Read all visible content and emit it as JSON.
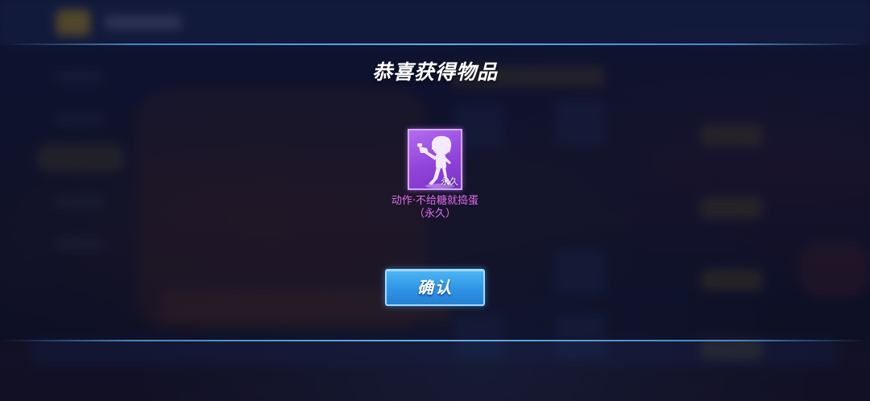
{
  "popup": {
    "title": "恭喜获得物品",
    "item": {
      "icon": "dancing-character-silhouette-icon",
      "duration_tag": "永久",
      "name": "动作·不给糖就捣蛋",
      "duration_label": "（永久）",
      "rarity_color": "#9143db",
      "name_color": "#e46cf0"
    },
    "confirm_label": "确认"
  },
  "colors": {
    "accent": "#2f94e6",
    "panel_line": "#6ebeff"
  }
}
